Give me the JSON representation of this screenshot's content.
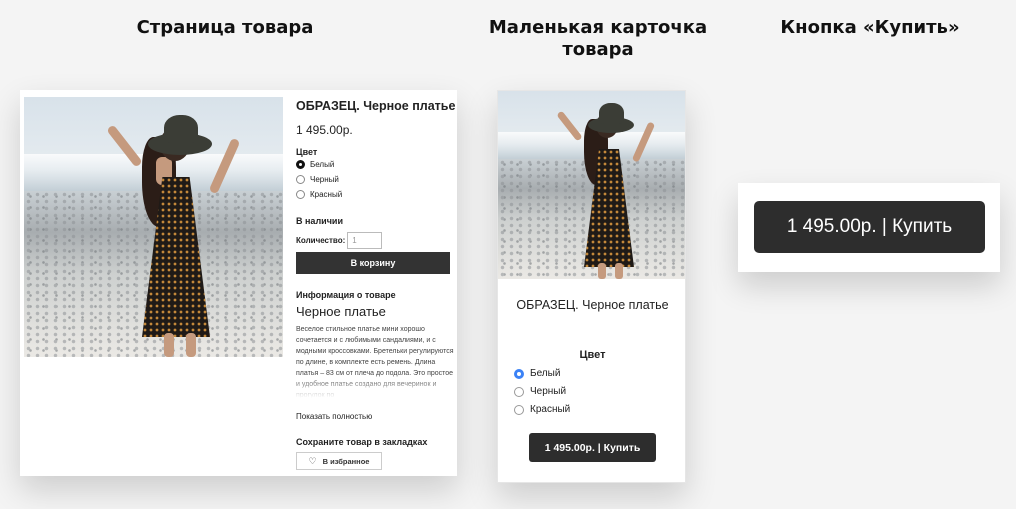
{
  "headings": {
    "product_page": "Страница товара",
    "small_card": "Маленькая карточка товара",
    "buy_button": "Кнопка «Купить»"
  },
  "product_page": {
    "title": "ОБРАЗЕЦ. Черное платье",
    "price": "1 495.00р.",
    "color_label": "Цвет",
    "colors": [
      {
        "label": "Белый",
        "selected": true
      },
      {
        "label": "Черный",
        "selected": false
      },
      {
        "label": "Красный",
        "selected": false
      }
    ],
    "availability": "В наличии",
    "quantity_label": "Количество:",
    "quantity_value": "1",
    "add_to_cart": "В корзину",
    "info_label": "Информация о товаре",
    "subtitle": "Черное платье",
    "description": "Веселое стильное платье мини хорошо сочетается и с любимыми сандалиями, и с модными кроссовками. Бретельки регулируются по длине, в комплекте есть ремень. Длина платья – 83 см от плеча до подола. Это простое и удобное платье создано для вечеринок и прогулок по",
    "show_more": "Показать полностью",
    "bookmark_label": "Сохраните товар в закладках",
    "favorite_button": "В избранное"
  },
  "small_card": {
    "title": "ОБРАЗЕЦ. Черное платье",
    "color_label": "Цвет",
    "colors": [
      {
        "label": "Белый",
        "selected": true
      },
      {
        "label": "Черный",
        "selected": false
      },
      {
        "label": "Красный",
        "selected": false
      }
    ],
    "buy_button": "1 495.00р. | Купить"
  },
  "buy_panel": {
    "button": "1 495.00р. | Купить"
  },
  "colors": {
    "button_dark": "#2d2d2d",
    "radio_active_blue": "#3b82f6",
    "page_bg": "#f4f4f4"
  }
}
